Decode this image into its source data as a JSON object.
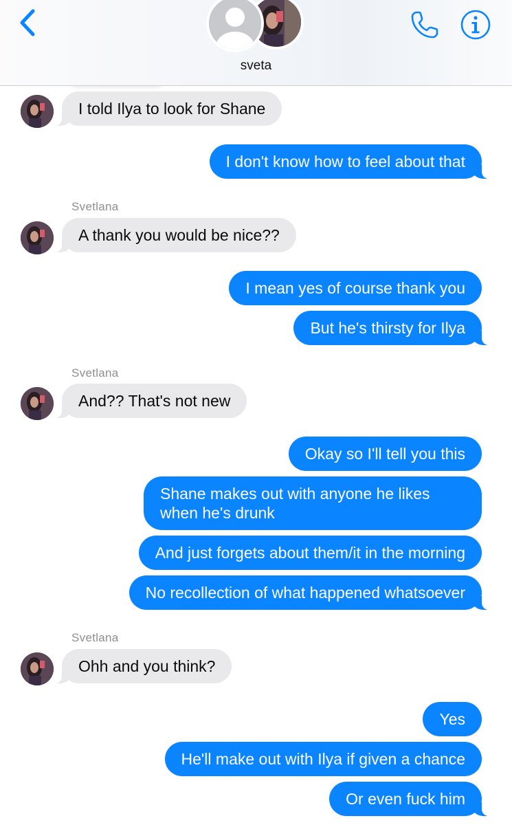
{
  "header": {
    "contact_name": "sveta",
    "icons": [
      "back-chevron-icon",
      "phone-icon",
      "info-icon"
    ],
    "accent_color": "#0a84ff"
  },
  "sender_name": "Svetlana",
  "messages": [
    {
      "dir": "in",
      "text": "I told Ilya to look for Shane"
    },
    {
      "dir": "out",
      "text": "I don't know how to feel about that"
    },
    {
      "dir": "in",
      "text": "A thank you would be nice??"
    },
    {
      "dir": "out",
      "text": "I mean yes of course thank you"
    },
    {
      "dir": "out",
      "text": "But he's thirsty for Ilya"
    },
    {
      "dir": "in",
      "text": "And?? That's not new"
    },
    {
      "dir": "out",
      "text": "Okay so I'll tell you this"
    },
    {
      "dir": "out",
      "text": "Shane makes out with anyone he likes when he's drunk"
    },
    {
      "dir": "out",
      "text": "And just forgets about them/it in the morning"
    },
    {
      "dir": "out",
      "text": "No recollection of what happened whatsoever"
    },
    {
      "dir": "in",
      "text": "Ohh and you think?"
    },
    {
      "dir": "out",
      "text": "Yes"
    },
    {
      "dir": "out",
      "text": "He'll make out with Ilya if given a chance"
    },
    {
      "dir": "out",
      "text": "Or even fuck him"
    }
  ],
  "colors": {
    "incoming_bubble": "#e9e9eb",
    "outgoing_bubble": "#0a84ff",
    "sender_label": "#8e8e93"
  }
}
